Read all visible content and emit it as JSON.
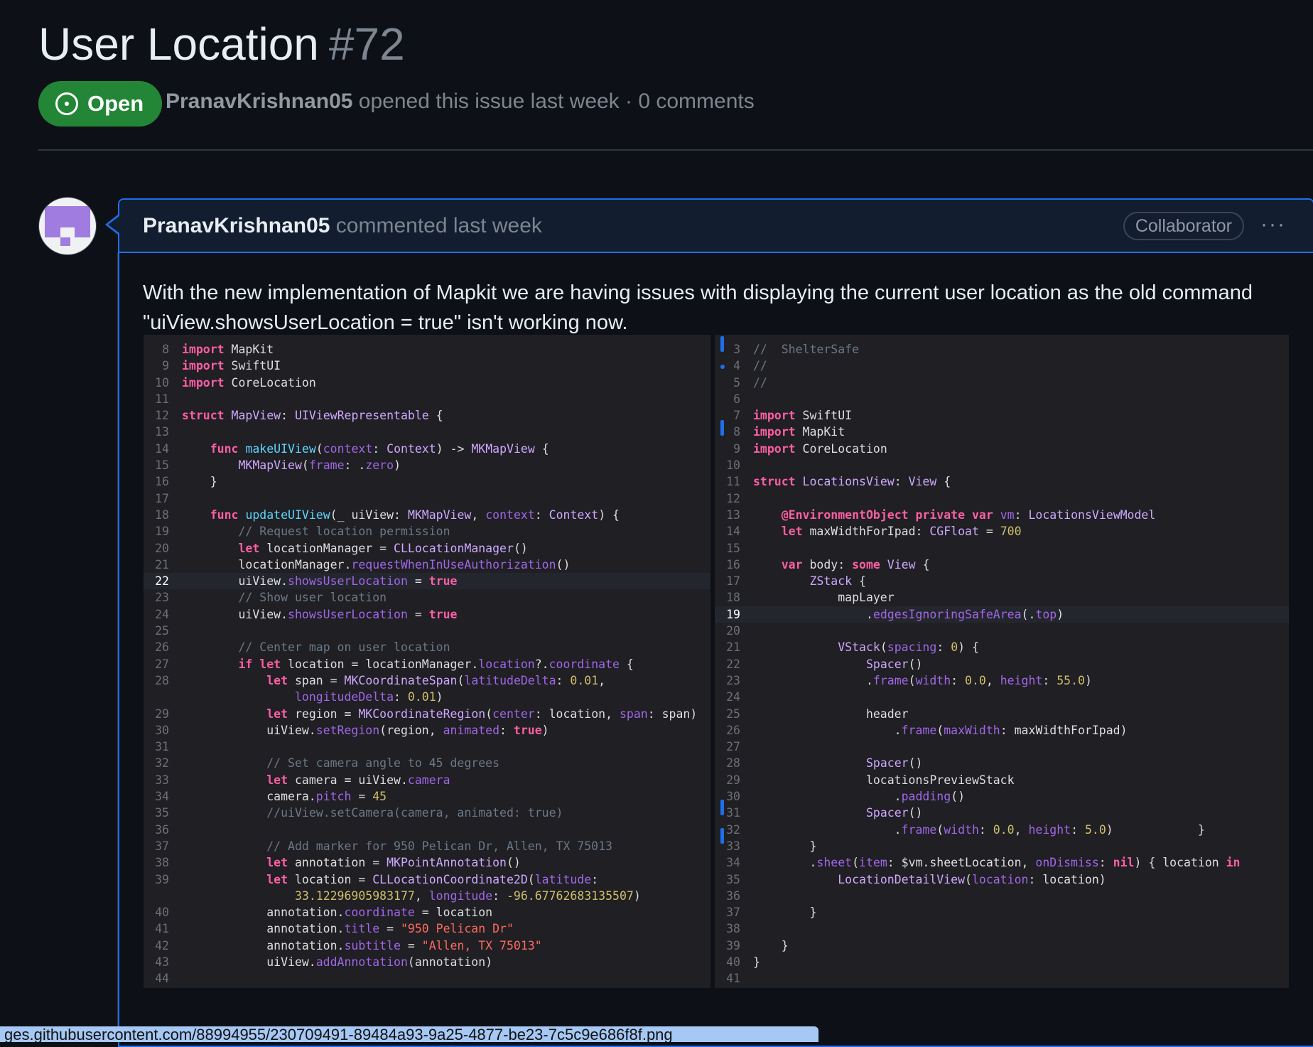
{
  "issue": {
    "title": "User Location",
    "number": "#72",
    "state": "Open",
    "author": "PranavKrishnan05",
    "meta_rest": "opened this issue last week · 0 comments"
  },
  "comment": {
    "author": "PranavKrishnan05",
    "time": "commented last week",
    "role_badge": "Collaborator",
    "menu": "···",
    "body": "With the new implementation of Mapkit we are having issues with displaying the current user location as the old command \"uiView.showsUserLocation = true\" isn't working now."
  },
  "status_url": "ges.githubusercontent.com/88994955/230709491-89484a93-9a25-4877-be23-7c5c9e686f8f.png",
  "colors": {
    "background": "#0d1117",
    "open_badge": "#238636",
    "comment_border": "#1f6feb",
    "comment_header": "#121d2f"
  },
  "code_left": [
    {
      "n": "8",
      "t": "import MapKit"
    },
    {
      "n": "9",
      "t": "import SwiftUI"
    },
    {
      "n": "10",
      "t": "import CoreLocation"
    },
    {
      "n": "11",
      "t": ""
    },
    {
      "n": "12",
      "t": "struct MapView: UIViewRepresentable {"
    },
    {
      "n": "13",
      "t": ""
    },
    {
      "n": "14",
      "t": "    func makeUIView(context: Context) -> MKMapView {"
    },
    {
      "n": "15",
      "t": "        MKMapView(frame: .zero)"
    },
    {
      "n": "16",
      "t": "    }"
    },
    {
      "n": "17",
      "t": ""
    },
    {
      "n": "18",
      "t": "    func updateUIView(_ uiView: MKMapView, context: Context) {"
    },
    {
      "n": "19",
      "t": "        // Request location permission"
    },
    {
      "n": "20",
      "t": "        let locationManager = CLLocationManager()"
    },
    {
      "n": "21",
      "t": "        locationManager.requestWhenInUseAuthorization()"
    },
    {
      "n": "22",
      "t": "        uiView.showsUserLocation = true"
    },
    {
      "n": "23",
      "t": "        // Show user location"
    },
    {
      "n": "24",
      "t": "        uiView.showsUserLocation = true"
    },
    {
      "n": "25",
      "t": ""
    },
    {
      "n": "26",
      "t": "        // Center map on user location"
    },
    {
      "n": "27",
      "t": "        if let location = locationManager.location?.coordinate {"
    },
    {
      "n": "28",
      "t": "            let span = MKCoordinateSpan(latitudeDelta: 0.01,"
    },
    {
      "n": "",
      "t": "                longitudeDelta: 0.01)"
    },
    {
      "n": "29",
      "t": "            let region = MKCoordinateRegion(center: location, span: span)"
    },
    {
      "n": "30",
      "t": "            uiView.setRegion(region, animated: true)"
    },
    {
      "n": "31",
      "t": ""
    },
    {
      "n": "32",
      "t": "            // Set camera angle to 45 degrees"
    },
    {
      "n": "33",
      "t": "            let camera = uiView.camera"
    },
    {
      "n": "34",
      "t": "            camera.pitch = 45"
    },
    {
      "n": "35",
      "t": "            //uiView.setCamera(camera, animated: true)"
    },
    {
      "n": "36",
      "t": ""
    },
    {
      "n": "37",
      "t": "            // Add marker for 950 Pelican Dr, Allen, TX 75013"
    },
    {
      "n": "38",
      "t": "            let annotation = MKPointAnnotation()"
    },
    {
      "n": "39",
      "t": "            let location = CLLocationCoordinate2D(latitude:"
    },
    {
      "n": "",
      "t": "                33.12296905983177, longitude: -96.67762683135507)"
    },
    {
      "n": "40",
      "t": "            annotation.coordinate = location"
    },
    {
      "n": "41",
      "t": "            annotation.title = \"950 Pelican Dr\""
    },
    {
      "n": "42",
      "t": "            annotation.subtitle = \"Allen, TX 75013\""
    },
    {
      "n": "43",
      "t": "            uiView.addAnnotation(annotation)"
    },
    {
      "n": "44",
      "t": ""
    }
  ],
  "code_right": [
    {
      "n": "3",
      "t": "//  ShelterSafe"
    },
    {
      "n": "4",
      "t": "//"
    },
    {
      "n": "5",
      "t": "//"
    },
    {
      "n": "6",
      "t": ""
    },
    {
      "n": "7",
      "t": "import SwiftUI"
    },
    {
      "n": "8",
      "t": "import MapKit"
    },
    {
      "n": "9",
      "t": "import CoreLocation"
    },
    {
      "n": "10",
      "t": ""
    },
    {
      "n": "11",
      "t": "struct LocationsView: View {"
    },
    {
      "n": "12",
      "t": ""
    },
    {
      "n": "13",
      "t": "    @EnvironmentObject private var vm: LocationsViewModel"
    },
    {
      "n": "14",
      "t": "    let maxWidthForIpad: CGFloat = 700"
    },
    {
      "n": "15",
      "t": ""
    },
    {
      "n": "16",
      "t": "    var body: some View {"
    },
    {
      "n": "17",
      "t": "        ZStack {"
    },
    {
      "n": "18",
      "t": "            mapLayer"
    },
    {
      "n": "19",
      "t": "                .edgesIgnoringSafeArea(.top)"
    },
    {
      "n": "20",
      "t": ""
    },
    {
      "n": "21",
      "t": "            VStack(spacing: 0) {"
    },
    {
      "n": "22",
      "t": "                Spacer()"
    },
    {
      "n": "23",
      "t": "                .frame(width: 0.0, height: 55.0)"
    },
    {
      "n": "24",
      "t": ""
    },
    {
      "n": "25",
      "t": "                header"
    },
    {
      "n": "26",
      "t": "                    .frame(maxWidth: maxWidthForIpad)"
    },
    {
      "n": "27",
      "t": ""
    },
    {
      "n": "28",
      "t": "                Spacer()"
    },
    {
      "n": "29",
      "t": "                locationsPreviewStack"
    },
    {
      "n": "30",
      "t": "                    .padding()"
    },
    {
      "n": "31",
      "t": "                Spacer()"
    },
    {
      "n": "32",
      "t": "                    .frame(width: 0.0, height: 5.0)            }"
    },
    {
      "n": "33",
      "t": "        }"
    },
    {
      "n": "34",
      "t": "        .sheet(item: $vm.sheetLocation, onDismiss: nil) { location in"
    },
    {
      "n": "35",
      "t": "            LocationDetailView(location: location)"
    },
    {
      "n": "36",
      "t": ""
    },
    {
      "n": "37",
      "t": "        }"
    },
    {
      "n": "38",
      "t": ""
    },
    {
      "n": "39",
      "t": "    }"
    },
    {
      "n": "40",
      "t": "}"
    },
    {
      "n": "41",
      "t": ""
    }
  ]
}
